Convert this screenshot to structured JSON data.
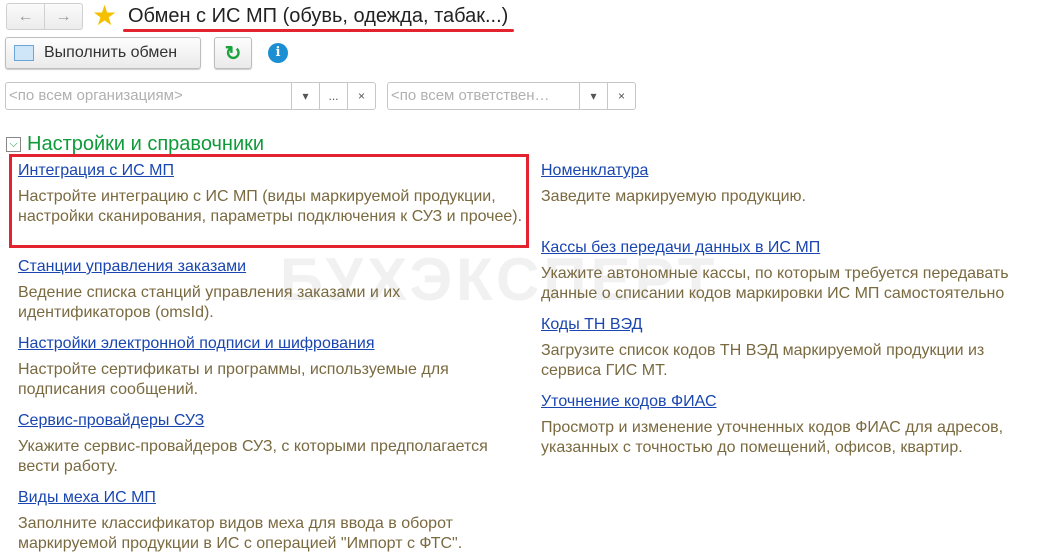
{
  "header": {
    "title": "Обмен с ИС МП (обувь, одежда, табак...)",
    "back": "←",
    "forward": "→"
  },
  "toolbar": {
    "exchange_label": "Выполнить обмен",
    "refresh": "↻",
    "info": "i"
  },
  "filters": {
    "organization_placeholder": "<по всем организациям>",
    "responsible_placeholder": "<по всем ответствен…",
    "dropdown": "▾",
    "select": "...",
    "clear": "×"
  },
  "section": {
    "title": "Настройки и справочники",
    "toggle": "⌵"
  },
  "watermark": "БУХЭКСПЕРТ",
  "left": [
    {
      "link": "Интеграция с ИС МП",
      "desc": "Настройте интеграцию с ИС МП (виды маркируемой продукции, настройки сканирования, параметры подключения к СУЗ и прочее)."
    },
    {
      "link": "Станции управления заказами",
      "desc": "Ведение списка станций управления заказами и их идентификаторов (omsId)."
    },
    {
      "link": "Настройки электронной подписи и шифрования",
      "desc": "Настройте сертификаты и программы, используемые для подписания сообщений."
    },
    {
      "link": "Сервис-провайдеры СУЗ",
      "desc": "Укажите сервис-провайдеров СУЗ, с которыми предполагается вести работу."
    },
    {
      "link": "Виды меха ИС МП",
      "desc": "Заполните классификатор видов меха для  ввода в оборот маркируемой продукции в ИС с операцией \"Импорт с ФТС\"."
    }
  ],
  "right": [
    {
      "link": "Номенклатура",
      "desc": "Заведите маркируемую продукцию."
    },
    {
      "link": "Кассы без передачи данных в ИС МП",
      "desc": "Укажите автономные кассы, по которым требуется передавать данные о списании кодов маркировки ИС МП самостоятельно"
    },
    {
      "link": "Коды ТН ВЭД",
      "desc": "Загрузите список кодов ТН ВЭД маркируемой продукции из сервиса ГИС МТ."
    },
    {
      "link": "Уточнение кодов ФИАС",
      "desc": "Просмотр и изменение уточненных кодов ФИАС для адресов, указанных с точностью до помещений, офисов, квартир."
    }
  ]
}
